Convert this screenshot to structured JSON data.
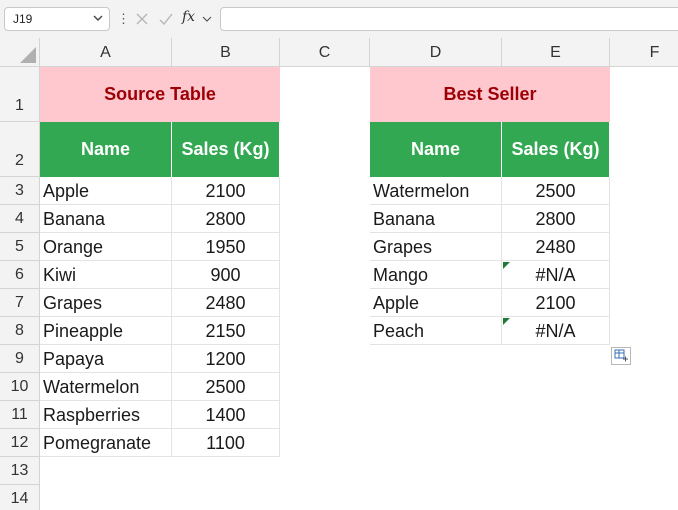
{
  "formula_bar": {
    "name_box": "J19",
    "fx_label": "fx",
    "formula": ""
  },
  "columns": [
    "A",
    "B",
    "C",
    "D",
    "E",
    "F"
  ],
  "rows": [
    "1",
    "2",
    "3",
    "4",
    "5",
    "6",
    "7",
    "8",
    "9",
    "10",
    "11",
    "12",
    "13",
    "14"
  ],
  "source_table": {
    "title": "Source Table",
    "headers": [
      "Name",
      "Sales (Kg)"
    ],
    "rows": [
      [
        "Apple",
        "2100"
      ],
      [
        "Banana",
        "2800"
      ],
      [
        "Orange",
        "1950"
      ],
      [
        "Kiwi",
        "900"
      ],
      [
        "Grapes",
        "2480"
      ],
      [
        "Pineapple",
        "2150"
      ],
      [
        "Papaya",
        "1200"
      ],
      [
        "Watermelon",
        "2500"
      ],
      [
        "Raspberries",
        "1400"
      ],
      [
        "Pomegranate",
        "1100"
      ]
    ]
  },
  "best_seller": {
    "title": "Best Seller",
    "headers": [
      "Name",
      "Sales (Kg)"
    ],
    "rows": [
      [
        "Watermelon",
        "2500"
      ],
      [
        "Banana",
        "2800"
      ],
      [
        "Grapes",
        "2480"
      ],
      [
        "Mango",
        "#N/A"
      ],
      [
        "Apple",
        "2100"
      ],
      [
        "Peach",
        "#N/A"
      ]
    ]
  },
  "colors": {
    "title_fill": "#ffc7ce",
    "title_text": "#9c0006",
    "header_fill": "#33a853",
    "header_text": "#ffffff",
    "error_indicator": "#1e7b34"
  },
  "icons": {
    "name_box_dropdown": "chevron-down-icon",
    "more_options": "vertical-ellipsis-icon",
    "cancel": "close-icon",
    "enter": "check-icon",
    "insert_function": "fx-icon",
    "paste_options": "paste-options-icon"
  }
}
